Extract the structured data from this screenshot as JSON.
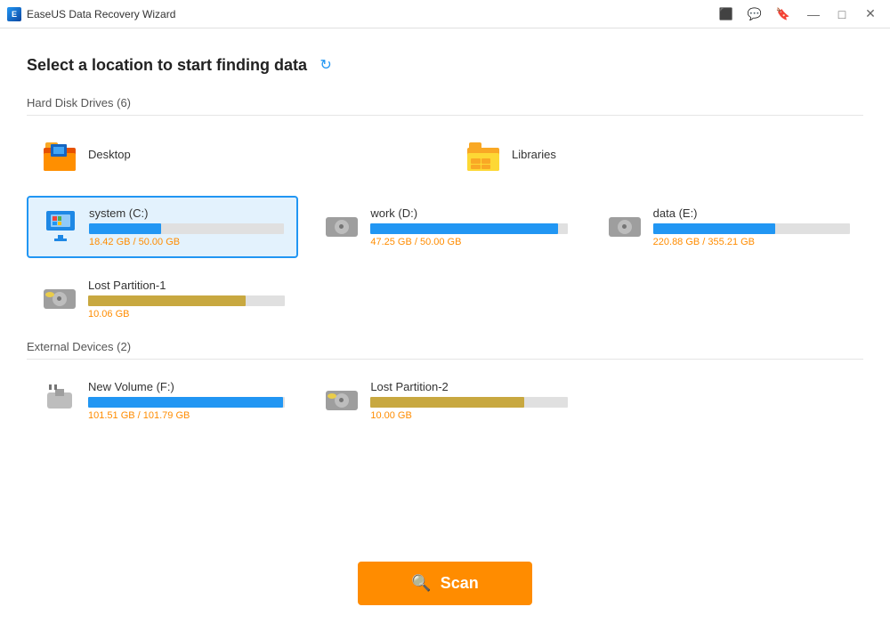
{
  "titleBar": {
    "appName": "EaseUS Data Recovery Wizard",
    "controls": {
      "minimize": "—",
      "maximize": "□",
      "close": "✕"
    }
  },
  "page": {
    "title": "Select a location to start finding data"
  },
  "hardDiskDrives": {
    "label": "Hard Disk Drives (6)",
    "items": [
      {
        "id": "desktop",
        "name": "Desktop",
        "type": "folder",
        "hasProgress": false
      },
      {
        "id": "libraries",
        "name": "Libraries",
        "type": "folder",
        "hasProgress": false
      },
      {
        "id": "systemC",
        "name": "system (C:)",
        "type": "system",
        "hasProgress": true,
        "progressPercent": 37,
        "progressColor": "blue",
        "sizeLabel": "18.42 GB / 50.00 GB",
        "selected": true
      },
      {
        "id": "workD",
        "name": "work (D:)",
        "type": "hdd",
        "hasProgress": true,
        "progressPercent": 95,
        "progressColor": "blue",
        "sizeLabel": "47.25 GB / 50.00 GB",
        "selected": false
      },
      {
        "id": "dataE",
        "name": "data (E:)",
        "type": "hdd",
        "hasProgress": true,
        "progressPercent": 62,
        "progressColor": "blue",
        "sizeLabel": "220.88 GB / 355.21 GB",
        "selected": false
      },
      {
        "id": "lostPartition1",
        "name": "Lost Partition-1",
        "type": "hdd",
        "hasProgress": true,
        "progressPercent": 80,
        "progressColor": "gold",
        "sizeLabel": "10.06 GB",
        "selected": false
      }
    ]
  },
  "externalDevices": {
    "label": "External Devices (2)",
    "items": [
      {
        "id": "newVolumeF",
        "name": "New Volume (F:)",
        "type": "usb",
        "hasProgress": true,
        "progressPercent": 99,
        "progressColor": "blue",
        "sizeLabel": "101.51 GB / 101.79 GB",
        "selected": false
      },
      {
        "id": "lostPartition2",
        "name": "Lost Partition-2",
        "type": "hdd",
        "hasProgress": true,
        "progressPercent": 78,
        "progressColor": "gold",
        "sizeLabel": "10.00 GB",
        "selected": false
      }
    ]
  },
  "scanButton": {
    "label": "Scan"
  }
}
